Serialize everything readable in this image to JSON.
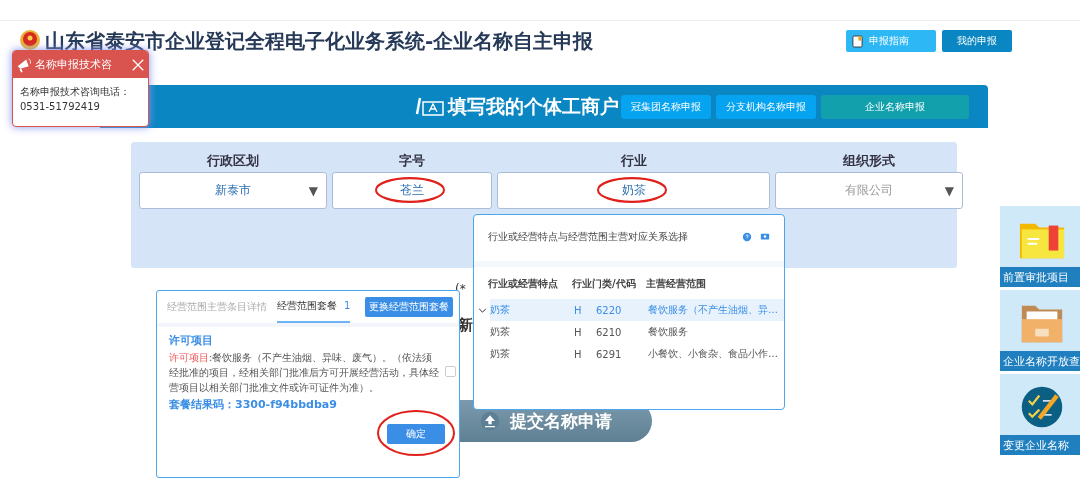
{
  "header": {
    "title": "山东省泰安市企业登记全程电子化业务系统-企业名称自主申报",
    "buttons": [
      {
        "label": "申报指南",
        "kind": "guide"
      },
      {
        "label": "我的申报",
        "kind": "mine"
      }
    ]
  },
  "consult_popup": {
    "title": "名称申报技术咨",
    "lines": [
      "名称申报技术咨询电话：",
      "0531-51792419"
    ]
  },
  "banner": {
    "heading": "填写我的个体工商户",
    "tabs": [
      {
        "label": "冠集团名称申报",
        "selected": false
      },
      {
        "label": "分支机构名称申报",
        "selected": false
      },
      {
        "label": "企业名称申报",
        "selected": true
      }
    ]
  },
  "form": {
    "fields": [
      {
        "label": "行政区划",
        "value": "新泰市",
        "kind": "select",
        "caret": "▼",
        "disabled": false,
        "circled": false
      },
      {
        "label": "字号",
        "value": "苍兰",
        "kind": "text",
        "disabled": false,
        "circled": true
      },
      {
        "label": "行业",
        "value": "奶茶",
        "kind": "text",
        "disabled": false,
        "circled": true
      },
      {
        "label": "组织形式",
        "value": "有限公司",
        "kind": "select",
        "caret": "▼",
        "disabled": true,
        "circled": false
      }
    ]
  },
  "behind": {
    "note": "(*",
    "heading": "新"
  },
  "submit_button": {
    "label": "提交名称申请"
  },
  "scope_dialog": {
    "tabs": [
      {
        "label": "经营范围主营条目详情",
        "selected": false
      },
      {
        "label": "经营范围套餐",
        "count": "1",
        "selected": true
      }
    ],
    "change_button": "更换经营范围套餐",
    "section_title": "许可项目",
    "description_prefix": "许可项目",
    "description": ":餐饮服务（不产生油烟、异味、废气）。（依法须经批准的项目，经相关部门批准后方可开展经营活动，具体经营项目以相关部门批准文件或许可证件为准）。",
    "checked": false,
    "result_code": "套餐结果码：3300-f94bbdba9",
    "confirm_button": {
      "label": "确定",
      "circled": true
    }
  },
  "industry_dialog": {
    "title": "行业或经营特点与经营范围主营对应关系选择",
    "columns": [
      "行业或经营特点",
      "行业门类/代码",
      "",
      "主营经营范围"
    ],
    "rows": [
      {
        "cells": [
          "奶茶",
          "H",
          "6220",
          "餐饮服务（不产生油烟、异…"
        ],
        "selected": true,
        "expanded": true
      },
      {
        "cells": [
          "奶茶",
          "H",
          "6210",
          "餐饮服务"
        ],
        "selected": false,
        "expanded": false
      },
      {
        "cells": [
          "奶茶",
          "H",
          "6291",
          "小餐饮、小食杂、食品小作…"
        ],
        "selected": false,
        "expanded": false
      }
    ]
  },
  "side_tiles": [
    {
      "label": "前置审批项目",
      "kind": "folder-bookmark"
    },
    {
      "label": "企业名称开放查",
      "kind": "folder-open"
    },
    {
      "label": "变更企业名称",
      "kind": "checklist"
    }
  ]
}
